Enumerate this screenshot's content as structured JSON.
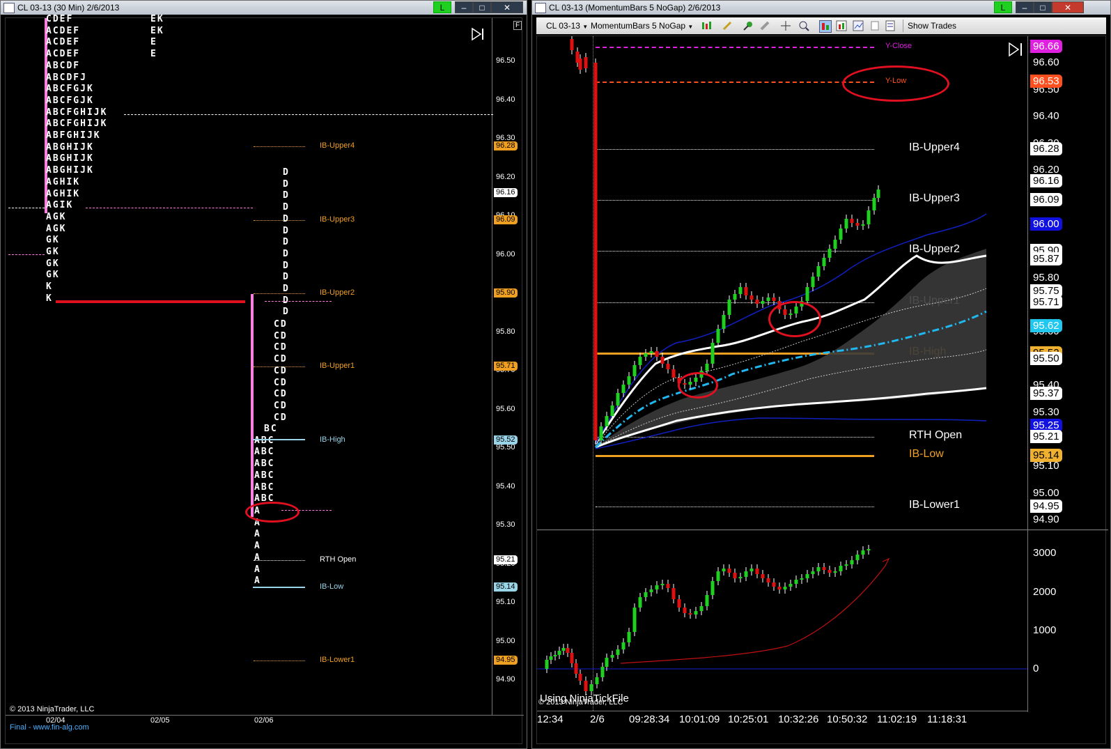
{
  "left_window": {
    "title": "CL 03-13 (30 Min)  2/6/2013",
    "connection_badge": "L",
    "price_axis": [
      "96.50",
      "96.40",
      "96.30",
      "96.20",
      "96.10",
      "96.00",
      "95.90",
      "95.80",
      "95.70",
      "95.60",
      "95.50",
      "95.40",
      "95.30",
      "95.20",
      "95.10",
      "95.00",
      "94.90"
    ],
    "price_tags": [
      {
        "text": "96.28",
        "color": "#f0a020"
      },
      {
        "text": "96.16",
        "color": "#ffffff"
      },
      {
        "text": "96.09",
        "color": "#f0a020"
      },
      {
        "text": "95.90",
        "color": "#f0a020"
      },
      {
        "text": "95.71",
        "color": "#f0a020"
      },
      {
        "text": "95.52",
        "color": "#9ad4e8"
      },
      {
        "text": "95.21",
        "color": "#ffffff"
      },
      {
        "text": "95.14",
        "color": "#9ad4e8"
      },
      {
        "text": "94.95",
        "color": "#f0a020"
      }
    ],
    "level_labels": [
      "IB-Upper4",
      "IB-Upper3",
      "IB-Upper2",
      "IB-Upper1",
      "IB-High",
      "RTH Open",
      "IB-Low",
      "IB-Lower1"
    ],
    "tpo_profile_0204": [
      "CDEF",
      "ACDEF",
      "ACDEF",
      "ACDEF",
      "ABCDF",
      "ABCDFJ",
      "ABCFGJK",
      "ABCFGJK",
      "ABCFGHIJK",
      "ABCFGHIJK",
      "ABFGHIJK",
      "ABGHIJK",
      "ABGHIJK",
      "ABGHIJK",
      "AGHIK",
      "AGHIK",
      "AGIK",
      "AGK",
      "AGK",
      "GK",
      "GK",
      "GK",
      "GK",
      "K",
      "K"
    ],
    "tpo_profile_0205": [
      "EK",
      "EK",
      "E",
      "E"
    ],
    "tpo_profile_0206_d": [
      "D",
      "D",
      "D",
      "D",
      "D",
      "D",
      "D",
      "D",
      "D",
      "D",
      "D",
      "D",
      "D"
    ],
    "tpo_profile_0206_cd": [
      "CD",
      "CD",
      "CD",
      "CD",
      "CD",
      "CD",
      "CD",
      "CD",
      "CD"
    ],
    "tpo_profile_0206_abc": [
      "BC",
      "ABC",
      "ABC",
      "ABC",
      "ABC",
      "ABC",
      "ABC"
    ],
    "tpo_profile_0206_a": [
      "A",
      "A",
      "A",
      "A",
      "A",
      "A",
      "A"
    ],
    "date_labels": [
      "02/04",
      "02/05",
      "02/06"
    ],
    "copyright": "© 2013 NinjaTrader, LLC",
    "footer_link": "Final - www.fin-alg.com",
    "panel_icon": "F"
  },
  "right_window": {
    "title": "CL 03-13 (MomentumBars 5 NoGap)  2/6/2013",
    "connection_badge": "L",
    "toolbar": {
      "instrument": "CL 03-13",
      "bar_type": "MomentumBars 5 NoGap",
      "show_trades": "Show Trades"
    },
    "price_axis": [
      "96.60",
      "96.50",
      "96.40",
      "96.30",
      "96.20",
      "96.10",
      "96.00",
      "95.90",
      "95.80",
      "95.70",
      "95.60",
      "95.50",
      "95.40",
      "95.30",
      "95.20",
      "95.10",
      "95.00",
      "94.90"
    ],
    "price_tags": [
      {
        "text": "96.66",
        "bg": "#e020e0",
        "fg": "#ffffff"
      },
      {
        "text": "96.53",
        "bg": "#ff5020",
        "fg": "#ffffff"
      },
      {
        "text": "96.28",
        "bg": "#ffffff",
        "fg": "#000000"
      },
      {
        "text": "96.16",
        "bg": "#ffffff",
        "fg": "#000000"
      },
      {
        "text": "96.09",
        "bg": "#ffffff",
        "fg": "#000000"
      },
      {
        "text": "96.00",
        "bg": "#1010e0",
        "fg": "#ffffff"
      },
      {
        "text": "95.90",
        "bg": "#ffffff",
        "fg": "#000000"
      },
      {
        "text": "95.87",
        "bg": "#ffffff",
        "fg": "#000000"
      },
      {
        "text": "95.75",
        "bg": "#ffffff",
        "fg": "#000000"
      },
      {
        "text": "95.71",
        "bg": "#ffffff",
        "fg": "#000000"
      },
      {
        "text": "95.62",
        "bg": "#20c8f0",
        "fg": "#ffffff"
      },
      {
        "text": "95.52",
        "bg": "#f0b030",
        "fg": "#000000"
      },
      {
        "text": "95.50",
        "bg": "#ffffff",
        "fg": "#000000"
      },
      {
        "text": "95.37",
        "bg": "#ffffff",
        "fg": "#000000"
      },
      {
        "text": "95.25",
        "bg": "#1010e0",
        "fg": "#ffffff"
      },
      {
        "text": "95.21",
        "bg": "#ffffff",
        "fg": "#000000"
      },
      {
        "text": "95.14",
        "bg": "#f0b030",
        "fg": "#000000"
      },
      {
        "text": "94.95",
        "bg": "#ffffff",
        "fg": "#000000"
      }
    ],
    "levels": [
      {
        "label": "Y-Close",
        "color": "#e020e0"
      },
      {
        "label": "Y-Low",
        "color": "#ff5020"
      },
      {
        "label": "IB-Upper4",
        "color": "#ffffff"
      },
      {
        "label": "IB-Upper3",
        "color": "#ffffff"
      },
      {
        "label": "IB-Upper2",
        "color": "#ffffff"
      },
      {
        "label": "IB-Upper1",
        "color": "#ffffff"
      },
      {
        "label": "IB-High",
        "color": "#f0a020"
      },
      {
        "label": "RTH Open",
        "color": "#ffffff"
      },
      {
        "label": "IB-Low",
        "color": "#f0a020"
      },
      {
        "label": "IB-Lower1",
        "color": "#ffffff"
      }
    ],
    "lower_axis": [
      "3000",
      "2000",
      "1000",
      "0"
    ],
    "tick_file_note": "Using NinjaTickFile",
    "copyright": "© 2013 NinjaTrader, LLC",
    "time_axis": [
      "12:34",
      "2/6",
      "09:28:34",
      "10:01:09",
      "10:25:01",
      "10:32:26",
      "10:50:32",
      "11:02:19",
      "11:18:31"
    ]
  },
  "colors": {
    "up_bar": "#20d020",
    "down_bar": "#e01010",
    "annotation": "#e01020",
    "tpo_bar": "#ff80e0"
  }
}
